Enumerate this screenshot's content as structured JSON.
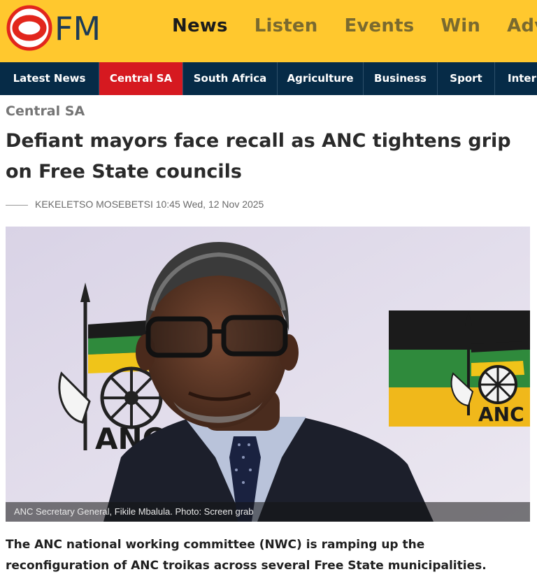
{
  "site": {
    "logo_text": "OFM",
    "brand_red": "#e2261c",
    "brand_yellow": "#ffc82e",
    "nav_dark": "#062b47"
  },
  "main_nav": [
    {
      "label": "News",
      "active": true
    },
    {
      "label": "Listen"
    },
    {
      "label": "Events"
    },
    {
      "label": "Win"
    },
    {
      "label": "Adv"
    }
  ],
  "category_nav": [
    {
      "label": "Latest News"
    },
    {
      "label": "Central SA",
      "active": true
    },
    {
      "label": "South Africa"
    },
    {
      "label": "Agriculture"
    },
    {
      "label": "Business"
    },
    {
      "label": "Sport"
    },
    {
      "label": "Intern"
    }
  ],
  "article": {
    "category": "Central SA",
    "headline": "Defiant mayors face recall as ANC tightens grip on Free State councils",
    "author": "KEKELETSO MOSEBETSI",
    "time": "10:45 Wed, 12 Nov 2025",
    "image_caption": "ANC Secretary General, Fikile Mbalula. Photo: Screen grab",
    "lead": "The ANC national working committee (NWC) is ramping up the reconfiguration of ANC troikas across several Free State municipalities."
  },
  "photo_text": {
    "flag_logo_left": "ANC",
    "flag_logo_right": "ANC"
  }
}
